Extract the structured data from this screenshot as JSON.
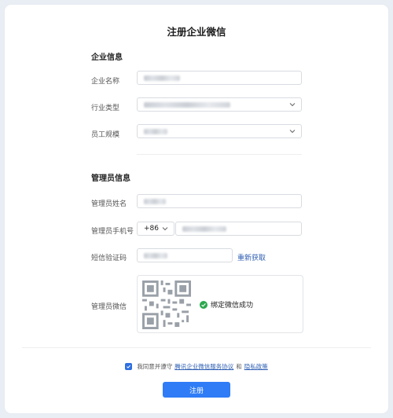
{
  "page": {
    "title": "注册企业微信"
  },
  "company_section": {
    "title": "企业信息",
    "name_label": "企业名称",
    "industry_label": "行业类型",
    "size_label": "员工规模"
  },
  "admin_section": {
    "title": "管理员信息",
    "name_label": "管理员姓名",
    "phone_label": "管理员手机号",
    "country_code": "+86",
    "code_label": "短信验证码",
    "resend_label": "重新获取",
    "wechat_label": "管理员微信",
    "bind_status": "绑定微信成功"
  },
  "footer": {
    "agree_prefix": "我同意并遵守",
    "terms_link": "腾讯企业微信服务协议",
    "and": "和",
    "privacy_link": "隐私政策",
    "agreed": true,
    "submit_label": "注册"
  },
  "colors": {
    "accent": "#2f7cf6",
    "link": "#2f5fb3",
    "success": "#2ca84f"
  }
}
